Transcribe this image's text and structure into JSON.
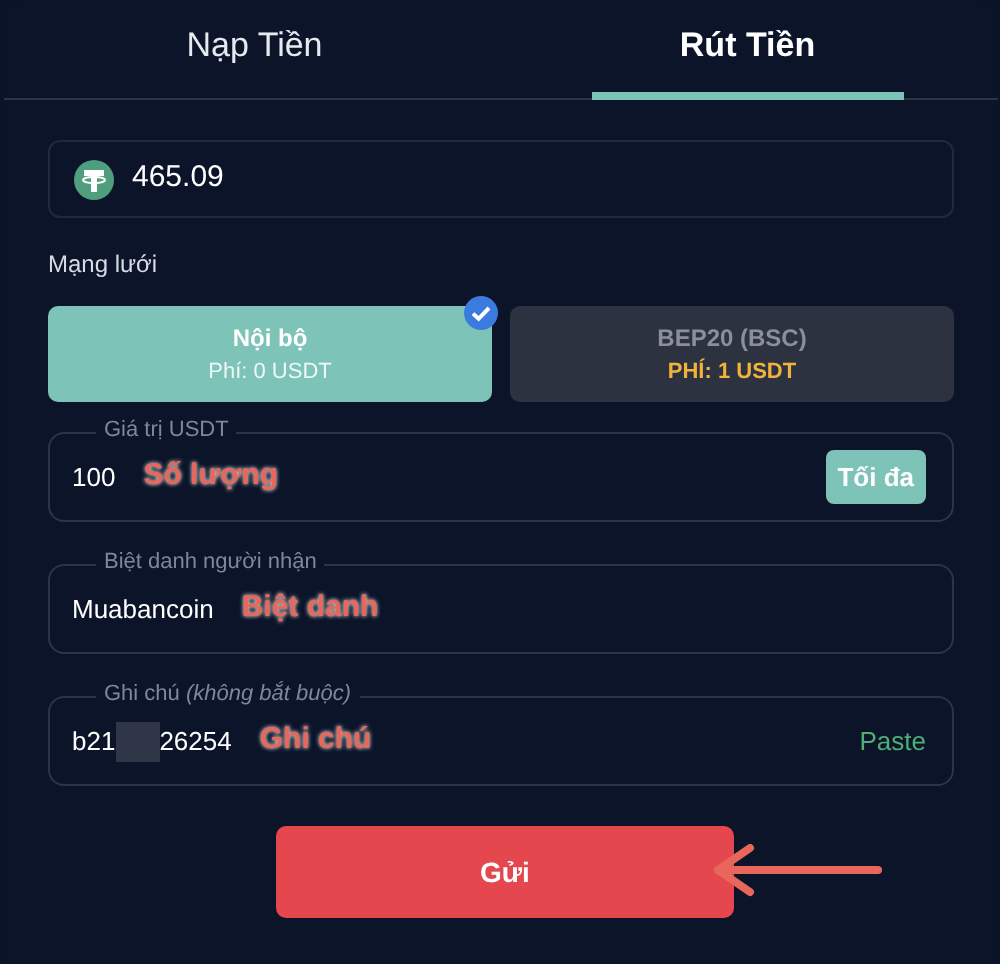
{
  "tabs": [
    {
      "label": "Nạp Tiền",
      "selected": false
    },
    {
      "label": "Rút Tiền",
      "selected": true
    }
  ],
  "balance": {
    "value": "465.09"
  },
  "network": {
    "label": "Mạng lưới",
    "options": [
      {
        "name": "Nội bộ",
        "fee": "Phí: 0 USDT",
        "selected": true
      },
      {
        "name": "BEP20 (BSC)",
        "fee": "PHÍ: 1 USDT",
        "selected": false
      }
    ]
  },
  "fields": [
    {
      "kind": "amount",
      "label": "Giá trị USDT",
      "value": "100",
      "annotation": "Số lượng",
      "action": "Tối đa"
    },
    {
      "kind": "plain",
      "label": "Biệt danh người nhận",
      "value": "Muabancoin",
      "annotation": "Biệt danh"
    },
    {
      "kind": "note",
      "label": "Ghi chú *(không bắt buộc)*",
      "value": "b21",
      "value_end": "26254",
      "redacted": true,
      "annotation": "Ghi chú",
      "action": "Paste"
    }
  ],
  "submit": {
    "label": "Gửi"
  }
}
